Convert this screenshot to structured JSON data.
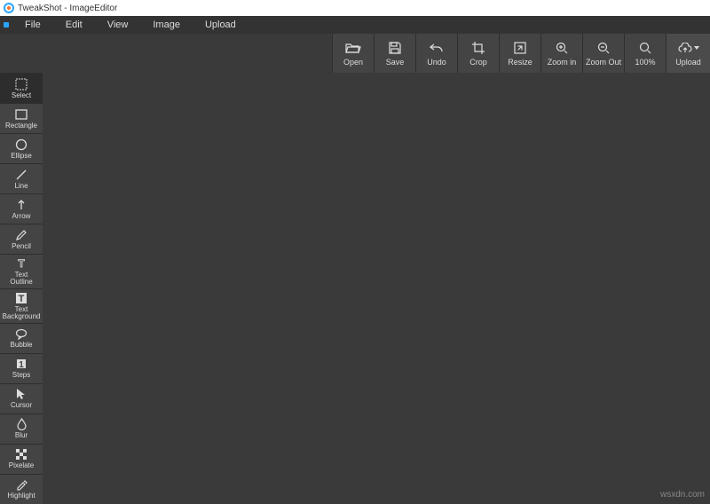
{
  "title": "TweakShot - ImageEditor",
  "menubar": {
    "items": [
      "File",
      "Edit",
      "View",
      "Image",
      "Upload"
    ]
  },
  "toolbar": {
    "open": "Open",
    "save": "Save",
    "undo": "Undo",
    "crop": "Crop",
    "resize": "Resize",
    "zoom_in": "Zoom in",
    "zoom_out": "Zoom Out",
    "zoom_100": "100%",
    "upload": "Upload"
  },
  "sidebar": {
    "select": "Select",
    "rectangle": "Rectangle",
    "ellipse": "Ellipse",
    "line": "Line",
    "arrow": "Arrow",
    "pencil": "Pencil",
    "text_outline": "Text\nOutline",
    "text_background": "Text\nBackground",
    "bubble": "Bubble",
    "steps": "Steps",
    "cursor": "Cursor",
    "blur": "Blur",
    "pixelate": "Pixelate",
    "highlight": "Highlight"
  },
  "watermark": "wsxdn.com"
}
